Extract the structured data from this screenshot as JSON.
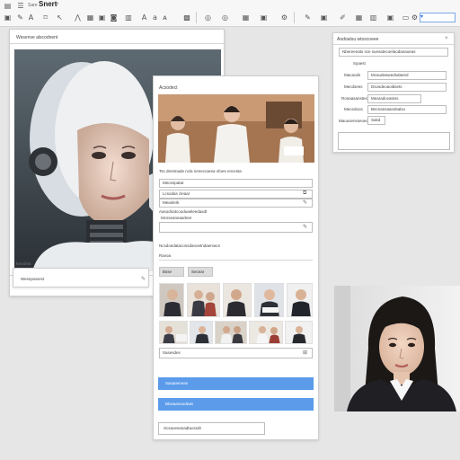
{
  "toolbar": {
    "title": "Snert",
    "menu_label": "Sare",
    "input_value": "",
    "icons": [
      "file-icon",
      "image-icon",
      "edit-icon",
      "text-icon",
      "crop-icon",
      "image-icon",
      "image-icon",
      "camera-icon",
      "slides-icon",
      "stamp-icon",
      "ring-icon",
      "ring-icon",
      "table-icon",
      "image-icon",
      "chart-icon",
      "image-icon",
      "settings-icon",
      "pencil-icon",
      "image-icon",
      "grid-icon",
      "folder-icon",
      "settings-icon"
    ]
  },
  "left_panel": {
    "title": "Wesenve alscodnent",
    "caption_label": "Keodnst",
    "caption_value": "Wesnpsarest"
  },
  "center_panel": {
    "title": "Acsodect",
    "description": "Tss dentmade ncla nenecoarea ofoes encesta",
    "fields": [
      {
        "label": "Mecespatat",
        "value": "",
        "icon": "edit-icon"
      },
      {
        "label": "Lcsodas cleaal",
        "value": "",
        "icon": "copy-icon"
      },
      {
        "label": "Meanlerk",
        "value": "",
        "icon": "edit-icon"
      }
    ],
    "note_label": "Aasodnatcooduaeleedasdt",
    "note_sub": "Mcsseaneaarleer",
    "summary_label": "Ncsdoedataconsdanoetndaemacs",
    "sub_label": "Ravoa",
    "tab_1": "Bsse",
    "tab_2": "Secear",
    "search_value": "Sasesdes",
    "primary_button": "Sasatemeas",
    "secondary_button": "Blosaanaodwat",
    "bottom_field": "Scsaoesanadtaossdt"
  },
  "right_panel": {
    "title": "Aodoatsu wtoscoeee",
    "header_row": "Nbereenats sce suesatecoelaodanaoeas",
    "rows": [
      {
        "label": "Syaest",
        "value": ""
      },
      {
        "label": "Macaods",
        "value": "Mcaudeawedsdaeed"
      },
      {
        "label": "Mecdsees",
        "value": "Dsosdeoaoldsets"
      },
      {
        "label": "Ronaasanstess",
        "value": "Mearadceatsss"
      },
      {
        "label": "Mecedoos",
        "value": "Becnansaandsalso"
      },
      {
        "label": "Maousensseoeds",
        "value": "Sakd"
      }
    ]
  },
  "colors": {
    "accent": "#5b9bea",
    "background": "#e6e6e6",
    "panel": "#ffffff"
  }
}
